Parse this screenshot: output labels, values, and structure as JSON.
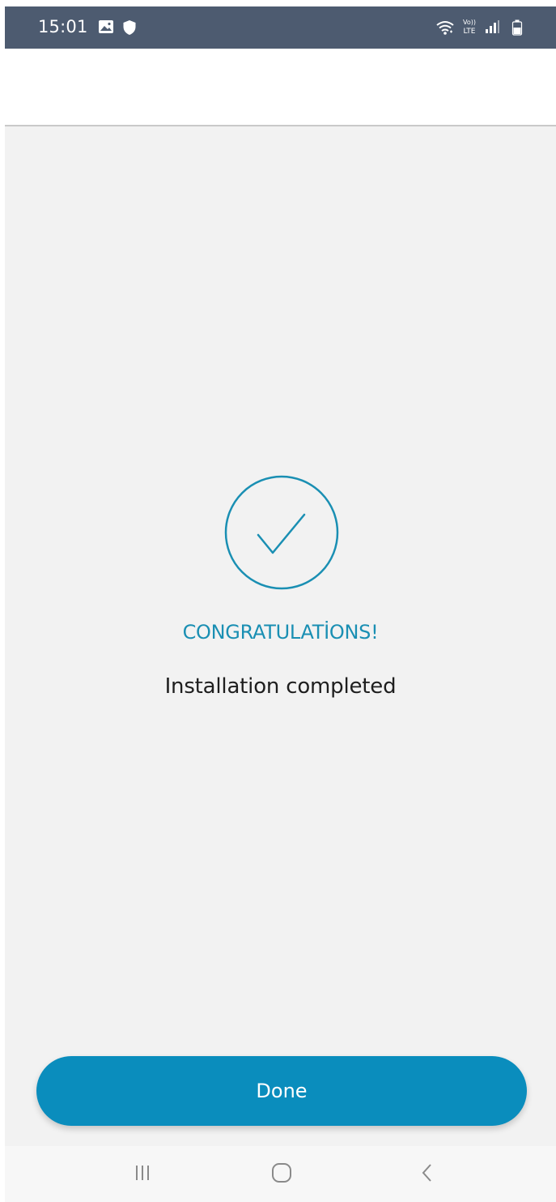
{
  "status_bar": {
    "time": "15:01",
    "left_icons": [
      "gallery-icon",
      "shield-icon"
    ],
    "right_icons": [
      "wifi-icon",
      "volte-lte-icon",
      "signal-icon",
      "battery-icon"
    ],
    "background_color": "#4d5b70"
  },
  "main": {
    "success_icon": "check-circle-icon",
    "title": "CONGRATULATİONS!",
    "message": "Installation completed",
    "accent_color": "#1a8fb3"
  },
  "actions": {
    "done_label": "Done",
    "button_color": "#0a8dbd"
  },
  "nav_bar": {
    "buttons": [
      "recents-icon",
      "home-icon",
      "back-icon"
    ]
  }
}
